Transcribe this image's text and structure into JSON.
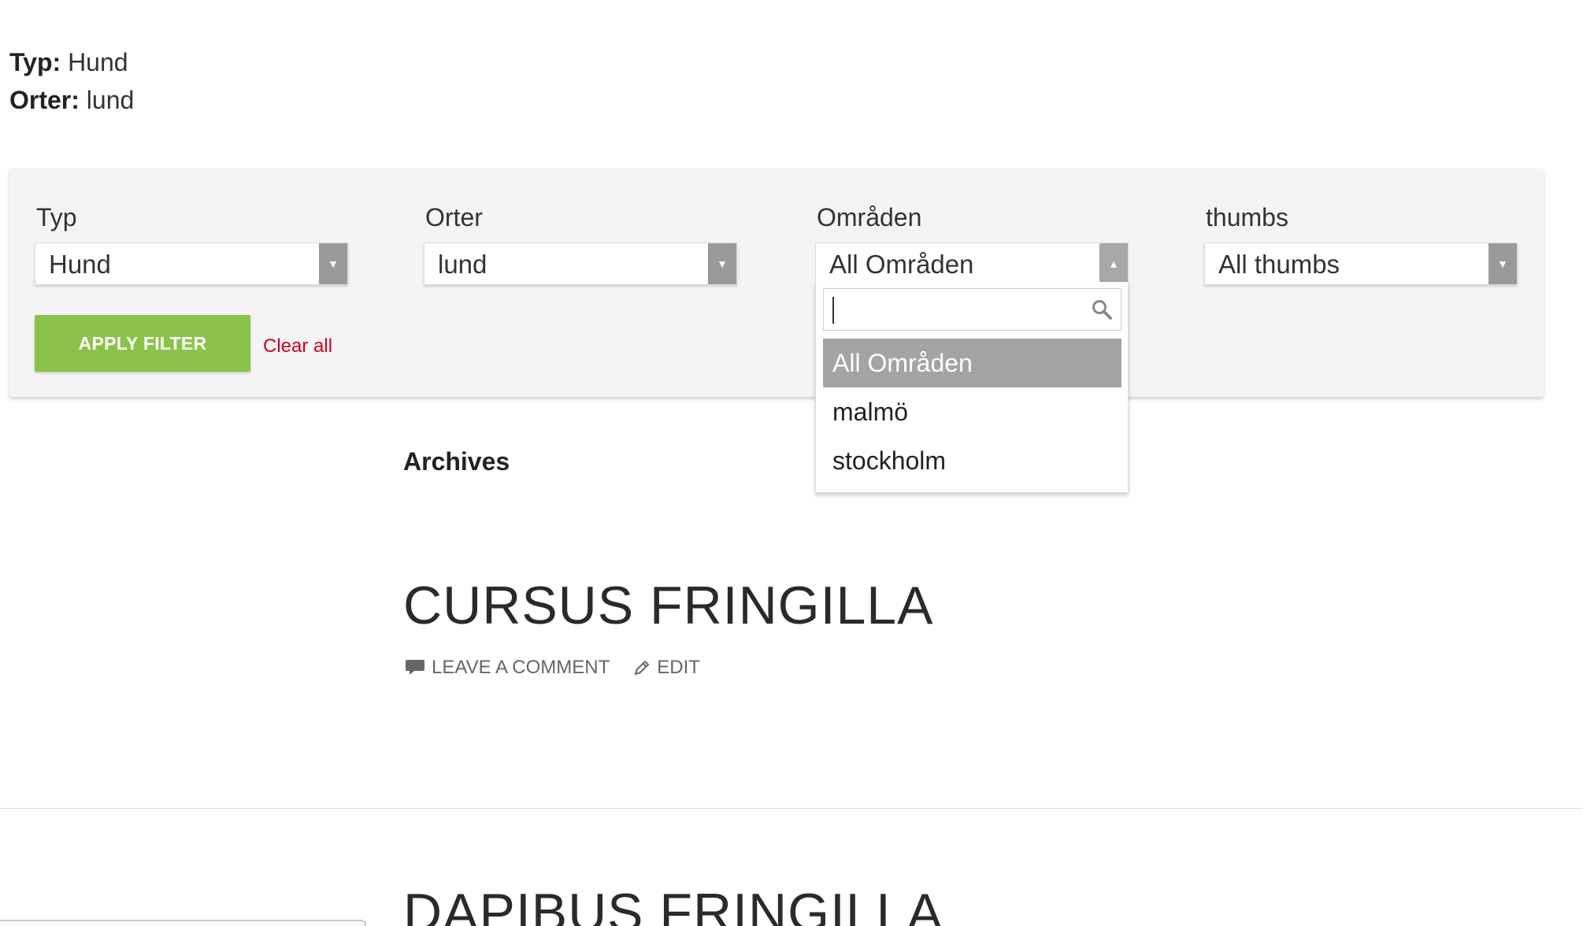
{
  "active_filters": [
    {
      "key": "Typ:",
      "value": "Hund"
    },
    {
      "key": "Orter:",
      "value": "lund"
    }
  ],
  "filters": [
    {
      "label": "Typ",
      "value": "Hund"
    },
    {
      "label": "Orter",
      "value": "lund"
    },
    {
      "label": "Områden",
      "value": "All Områden"
    },
    {
      "label": "thumbs",
      "value": "All thumbs"
    }
  ],
  "apply_button": "APPLY FILTER",
  "clear_link": "Clear all",
  "dropdown": {
    "search_value": "",
    "options": [
      "All Områden",
      "malmö",
      "stockholm"
    ],
    "selected_index": 0
  },
  "archives_title": "Archives",
  "posts": [
    {
      "title": "CURSUS FRINGILLA",
      "leave_comment": "LEAVE A COMMENT",
      "edit": "EDIT"
    },
    {
      "title": "DAPIBUS FRINGILLA"
    }
  ],
  "colors": {
    "apply_green": "#8bc34a",
    "clear_red": "#d0021b",
    "selected_option": "#a4a4a4",
    "panel_bg": "#f4f4f4"
  }
}
